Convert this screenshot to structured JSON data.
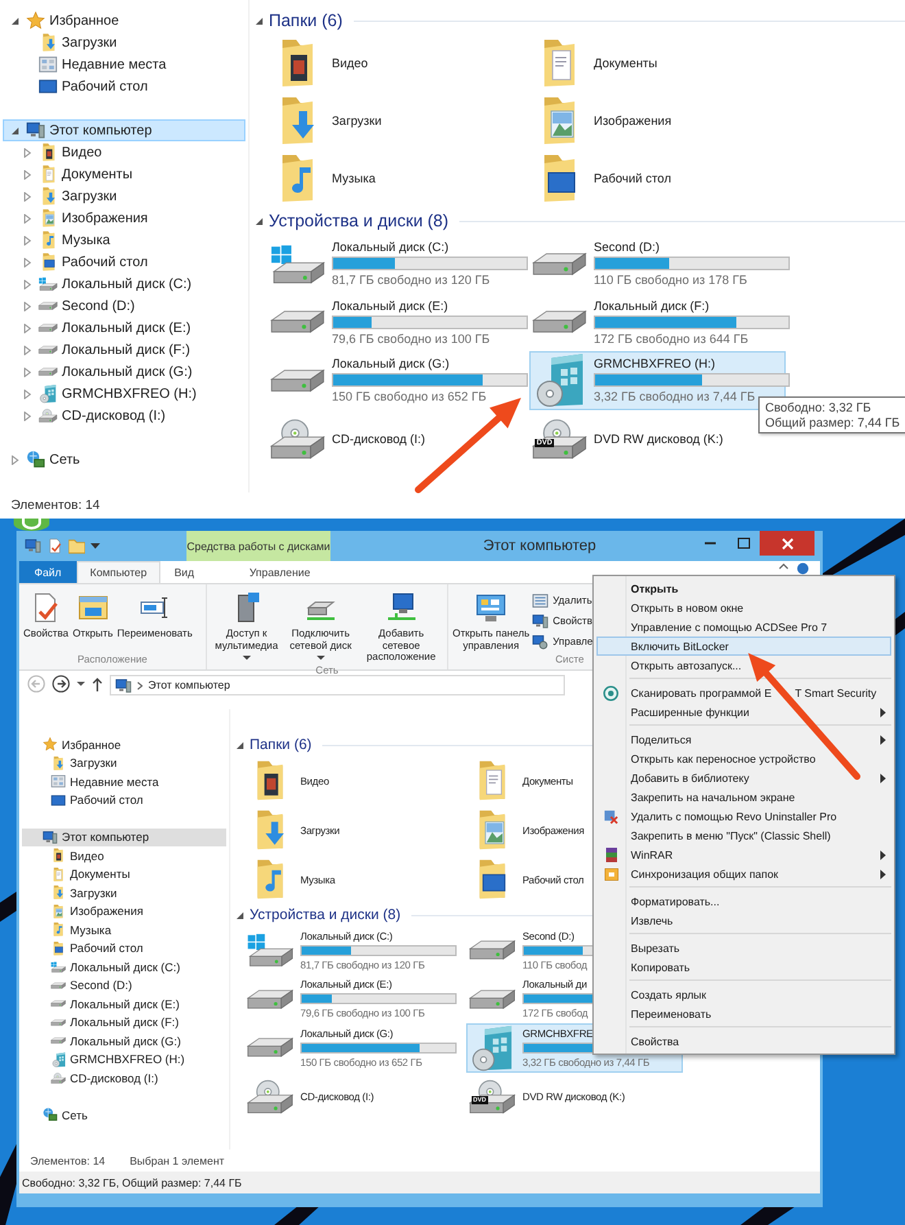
{
  "top_view": {
    "sidebar": {
      "focused": true,
      "nodes": [
        {
          "label": "Избранное",
          "kind": "favorites",
          "expanded": true,
          "selected": false,
          "children": [
            {
              "label": "Загрузки",
              "kind": "downloads",
              "selected": false
            },
            {
              "label": "Недавние места",
              "kind": "recent",
              "selected": false
            },
            {
              "label": "Рабочий стол",
              "kind": "desktop_link",
              "selected": false
            }
          ]
        },
        {
          "label": "Этот компьютер",
          "kind": "computer",
          "expanded": true,
          "selected": true,
          "children": [
            {
              "label": "Видео",
              "kind": "video",
              "expanded": false,
              "selected": false
            },
            {
              "label": "Документы",
              "kind": "documents",
              "expanded": false,
              "selected": false
            },
            {
              "label": "Загрузки",
              "kind": "downloads",
              "expanded": false,
              "selected": false
            },
            {
              "label": "Изображения",
              "kind": "pictures",
              "expanded": false,
              "selected": false
            },
            {
              "label": "Музыка",
              "kind": "music",
              "expanded": false,
              "selected": false
            },
            {
              "label": "Рабочий стол",
              "kind": "desktop",
              "expanded": false,
              "selected": false
            },
            {
              "label": "Локальный диск (C:)",
              "kind": "system",
              "expanded": false,
              "selected": false
            },
            {
              "label": "Second (D:)",
              "kind": "drive",
              "expanded": false,
              "selected": false
            },
            {
              "label": "Локальный диск (E:)",
              "kind": "drive",
              "expanded": false,
              "selected": false
            },
            {
              "label": "Локальный диск (F:)",
              "kind": "drive",
              "expanded": false,
              "selected": false
            },
            {
              "label": "Локальный диск (G:)",
              "kind": "drive",
              "expanded": false,
              "selected": false
            },
            {
              "label": "GRMCHBXFREO (H:)",
              "kind": "removable",
              "expanded": false,
              "selected": false
            },
            {
              "label": "CD-дисковод (I:)",
              "kind": "cd",
              "expanded": false,
              "selected": false
            }
          ]
        },
        {
          "label": "Сеть",
          "kind": "network",
          "expanded": false,
          "selected": false
        }
      ]
    },
    "sections": [
      {
        "title": "Папки (6)",
        "kind": "folders",
        "expanded": true,
        "items": [
          {
            "name": "Видео",
            "kind": "video",
            "selected": false
          },
          {
            "name": "Документы",
            "kind": "documents",
            "selected": false
          },
          {
            "name": "Загрузки",
            "kind": "downloads",
            "selected": false
          },
          {
            "name": "Изображения",
            "kind": "pictures",
            "selected": false
          },
          {
            "name": "Музыка",
            "kind": "music",
            "selected": false
          },
          {
            "name": "Рабочий стол",
            "kind": "desktop",
            "selected": false
          }
        ]
      },
      {
        "title": "Устройства и диски (8)",
        "kind": "drives",
        "expanded": true,
        "items": [
          {
            "name": "Локальный диск (C:)",
            "kind": "system",
            "level": 0.32,
            "free": "81,7 ГБ свободно из 120 ГБ",
            "selected": false
          },
          {
            "name": "Second (D:)",
            "kind": "drive",
            "level": 0.38,
            "free": "110 ГБ свободно из 178 ГБ",
            "selected": false
          },
          {
            "name": "Локальный диск (E:)",
            "kind": "drive",
            "level": 0.2,
            "free": "79,6 ГБ свободно из 100 ГБ",
            "selected": false
          },
          {
            "name": "Локальный диск (F:)",
            "kind": "drive",
            "level": 0.73,
            "free": "172 ГБ свободно из 644 ГБ",
            "selected": false
          },
          {
            "name": "Локальный диск (G:)",
            "kind": "drive",
            "level": 0.77,
            "free": "150 ГБ свободно из 652 ГБ",
            "selected": false
          },
          {
            "name": "GRMCHBXFREO (H:)",
            "kind": "removable",
            "level": 0.55,
            "free": "3,32 ГБ свободно из 7,44 ГБ",
            "selected": true
          },
          {
            "name": "CD-дисковод (I:)",
            "kind": "cd",
            "selected": false
          },
          {
            "name": "DVD RW дисковод (K:)",
            "kind": "dvd",
            "icon_label": "DVD",
            "selected": false
          }
        ]
      }
    ],
    "tooltip": [
      "Свободно: 3,32 ГБ",
      "Общий размер: 7,44 ГБ"
    ],
    "status": [
      "Элементов: 14"
    ]
  },
  "window": {
    "title": "Этот компьютер",
    "context_tab": "Средства работы с дисками",
    "tabs": [
      {
        "label": "Файл",
        "kind": "file",
        "selected": false
      },
      {
        "label": "Компьютер",
        "kind": "tab",
        "selected": true
      },
      {
        "label": "Вид",
        "kind": "tab",
        "selected": false
      },
      {
        "label": "Управление",
        "kind": "context",
        "selected": false
      }
    ],
    "ribbon_groups": [
      {
        "label": "Расположение",
        "buttons": [
          {
            "label": "Свойства",
            "kind": "properties",
            "dropdown": false
          },
          {
            "label": "Открыть",
            "kind": "open",
            "dropdown": false
          },
          {
            "label": "Переименовать",
            "kind": "rename",
            "dropdown": false
          }
        ]
      },
      {
        "label": "Сеть",
        "buttons": [
          {
            "label": "Доступ к\nмультимедиа",
            "kind": "media",
            "dropdown": true
          },
          {
            "label": "Подключить\nсетевой диск",
            "kind": "map_drive",
            "dropdown": true
          },
          {
            "label": "Добавить сетевое\nрасположение",
            "kind": "add_location",
            "dropdown": false
          }
        ]
      },
      {
        "label": "Систе",
        "buttons": [
          {
            "label": "Открыть панель\nуправления",
            "kind": "control_panel",
            "dropdown": false
          }
        ],
        "small_buttons": [
          {
            "label": "Удалить",
            "kind": "uninstall"
          },
          {
            "label": "Свойств",
            "kind": "system"
          },
          {
            "label": "Управле",
            "kind": "manage"
          }
        ]
      }
    ],
    "address": "Этот компьютер",
    "view": {
      "sidebar": {
        "focused": false,
        "nodes": [
          {
            "label": "Избранное",
            "kind": "favorites",
            "selected": false,
            "children": [
              {
                "label": "Загрузки",
                "kind": "downloads",
                "selected": false
              },
              {
                "label": "Недавние места",
                "kind": "recent",
                "selected": false
              },
              {
                "label": "Рабочий стол",
                "kind": "desktop_link",
                "selected": false
              }
            ]
          },
          {
            "label": "Этот компьютер",
            "kind": "computer",
            "selected": true,
            "children": [
              {
                "label": "Видео",
                "kind": "video",
                "selected": false
              },
              {
                "label": "Документы",
                "kind": "documents",
                "selected": false
              },
              {
                "label": "Загрузки",
                "kind": "downloads",
                "selected": false
              },
              {
                "label": "Изображения",
                "kind": "pictures",
                "selected": false
              },
              {
                "label": "Музыка",
                "kind": "music",
                "selected": false
              },
              {
                "label": "Рабочий стол",
                "kind": "desktop",
                "selected": false
              },
              {
                "label": "Локальный диск (C:)",
                "kind": "system",
                "selected": false
              },
              {
                "label": "Second (D:)",
                "kind": "drive",
                "selected": false
              },
              {
                "label": "Локальный диск (E:)",
                "kind": "drive",
                "selected": false
              },
              {
                "label": "Локальный диск (F:)",
                "kind": "drive",
                "selected": false
              },
              {
                "label": "Локальный диск (G:)",
                "kind": "drive",
                "selected": false
              },
              {
                "label": "GRMCHBXFREO (H:)",
                "kind": "removable",
                "selected": false
              },
              {
                "label": "CD-дисковод (I:)",
                "kind": "cd",
                "selected": false
              }
            ]
          },
          {
            "label": "Сеть",
            "kind": "network",
            "selected": false
          }
        ]
      },
      "sections": [
        {
          "title": "Папки (6)",
          "kind": "folders",
          "expanded": true,
          "items": [
            {
              "name": "Видео",
              "kind": "video",
              "selected": false
            },
            {
              "name": "Документы",
              "kind": "documents",
              "selected": false
            },
            {
              "name": "Загрузки",
              "kind": "downloads",
              "selected": false
            },
            {
              "name": "Изображения",
              "kind": "pictures",
              "selected": false
            },
            {
              "name": "Музыка",
              "kind": "music",
              "selected": false
            },
            {
              "name": "Рабочий стол",
              "kind": "desktop",
              "selected": false
            }
          ]
        },
        {
          "title": "Устройства и диски (8)",
          "kind": "drives",
          "expanded": true,
          "items": [
            {
              "name": "Локальный диск (C:)",
              "kind": "system",
              "level": 0.32,
              "free": "81,7 ГБ свободно из 120 ГБ",
              "selected": false
            },
            {
              "name": "Second (D:)",
              "kind": "drive",
              "level": 0.38,
              "free": "110 ГБ свобод",
              "selected": false
            },
            {
              "name": "Локальный диск (E:)",
              "kind": "drive",
              "level": 0.2,
              "free": "79,6 ГБ свободно из 100 ГБ",
              "selected": false
            },
            {
              "name": "Локальный ди",
              "kind": "drive",
              "level": 0.73,
              "free": "172 ГБ свобод",
              "selected": false
            },
            {
              "name": "Локальный диск (G:)",
              "kind": "drive",
              "level": 0.77,
              "free": "150 ГБ свободно из 652 ГБ",
              "selected": false
            },
            {
              "name": "GRMCHBXFRE",
              "kind": "removable",
              "level": 0.55,
              "free": "3,32 ГБ свободно из 7,44 ГБ",
              "selected": true
            },
            {
              "name": "CD-дисковод (I:)",
              "kind": "cd",
              "selected": false
            },
            {
              "name": "DVD RW дисковод (K:)",
              "kind": "dvd",
              "icon_label": "DVD",
              "selected": false
            }
          ]
        }
      ],
      "status": [
        "Элементов: 14",
        "Выбран 1 элемент"
      ]
    },
    "details_bar": "Свободно: 3,32 ГБ, Общий размер: 7,44 ГБ"
  },
  "context_menu": [
    {
      "kind": "item",
      "label": "Открыть",
      "default": true,
      "submenu": false,
      "selected": false
    },
    {
      "kind": "item",
      "label": "Открыть в новом окне",
      "default": false,
      "submenu": false,
      "selected": false
    },
    {
      "kind": "item",
      "label": "Управление с помощью ACDSee Pro 7",
      "default": false,
      "submenu": false,
      "selected": false
    },
    {
      "kind": "item",
      "label": "Включить BitLocker",
      "default": false,
      "submenu": false,
      "selected": true
    },
    {
      "kind": "item",
      "label": "Открыть автозапуск...",
      "default": false,
      "submenu": false,
      "selected": false
    },
    {
      "kind": "separator"
    },
    {
      "kind": "scan",
      "label": "Сканировать программой E",
      "label_tail": "T Smart Security",
      "default": false,
      "submenu": false,
      "selected": false
    },
    {
      "kind": "item",
      "label": "Расширенные функции",
      "default": false,
      "submenu": true,
      "selected": false
    },
    {
      "kind": "separator"
    },
    {
      "kind": "item",
      "label": "Поделиться",
      "default": false,
      "submenu": true,
      "selected": false
    },
    {
      "kind": "item",
      "label": "Открыть как переносное устройство",
      "default": false,
      "submenu": false,
      "selected": false
    },
    {
      "kind": "item",
      "label": "Добавить в библиотеку",
      "default": false,
      "submenu": true,
      "selected": false
    },
    {
      "kind": "item",
      "label": "Закрепить на начальном экране",
      "default": false,
      "submenu": false,
      "selected": false
    },
    {
      "kind": "uninstall",
      "label": "Удалить с помощью Revo Uninstaller Pro",
      "default": false,
      "submenu": false,
      "selected": false
    },
    {
      "kind": "item",
      "label": "Закрепить в меню \"Пуск\" (Classic Shell)",
      "default": false,
      "submenu": false,
      "selected": false
    },
    {
      "kind": "archive",
      "label": "WinRAR",
      "default": false,
      "submenu": true,
      "selected": false
    },
    {
      "kind": "sync",
      "label": "Синхронизация общих папок",
      "default": false,
      "submenu": true,
      "selected": false
    },
    {
      "kind": "separator"
    },
    {
      "kind": "item",
      "label": "Форматировать...",
      "default": false,
      "submenu": false,
      "selected": false
    },
    {
      "kind": "item",
      "label": "Извлечь",
      "default": false,
      "submenu": false,
      "selected": false
    },
    {
      "kind": "separator"
    },
    {
      "kind": "item",
      "label": "Вырезать",
      "default": false,
      "submenu": false,
      "selected": false
    },
    {
      "kind": "item",
      "label": "Копировать",
      "default": false,
      "submenu": false,
      "selected": false
    },
    {
      "kind": "separator"
    },
    {
      "kind": "item",
      "label": "Создать ярлык",
      "default": false,
      "submenu": false,
      "selected": false
    },
    {
      "kind": "item",
      "label": "Переименовать",
      "default": false,
      "submenu": false,
      "selected": false
    },
    {
      "kind": "separator"
    },
    {
      "kind": "item",
      "label": "Свойства",
      "default": false,
      "submenu": false,
      "selected": false
    }
  ]
}
